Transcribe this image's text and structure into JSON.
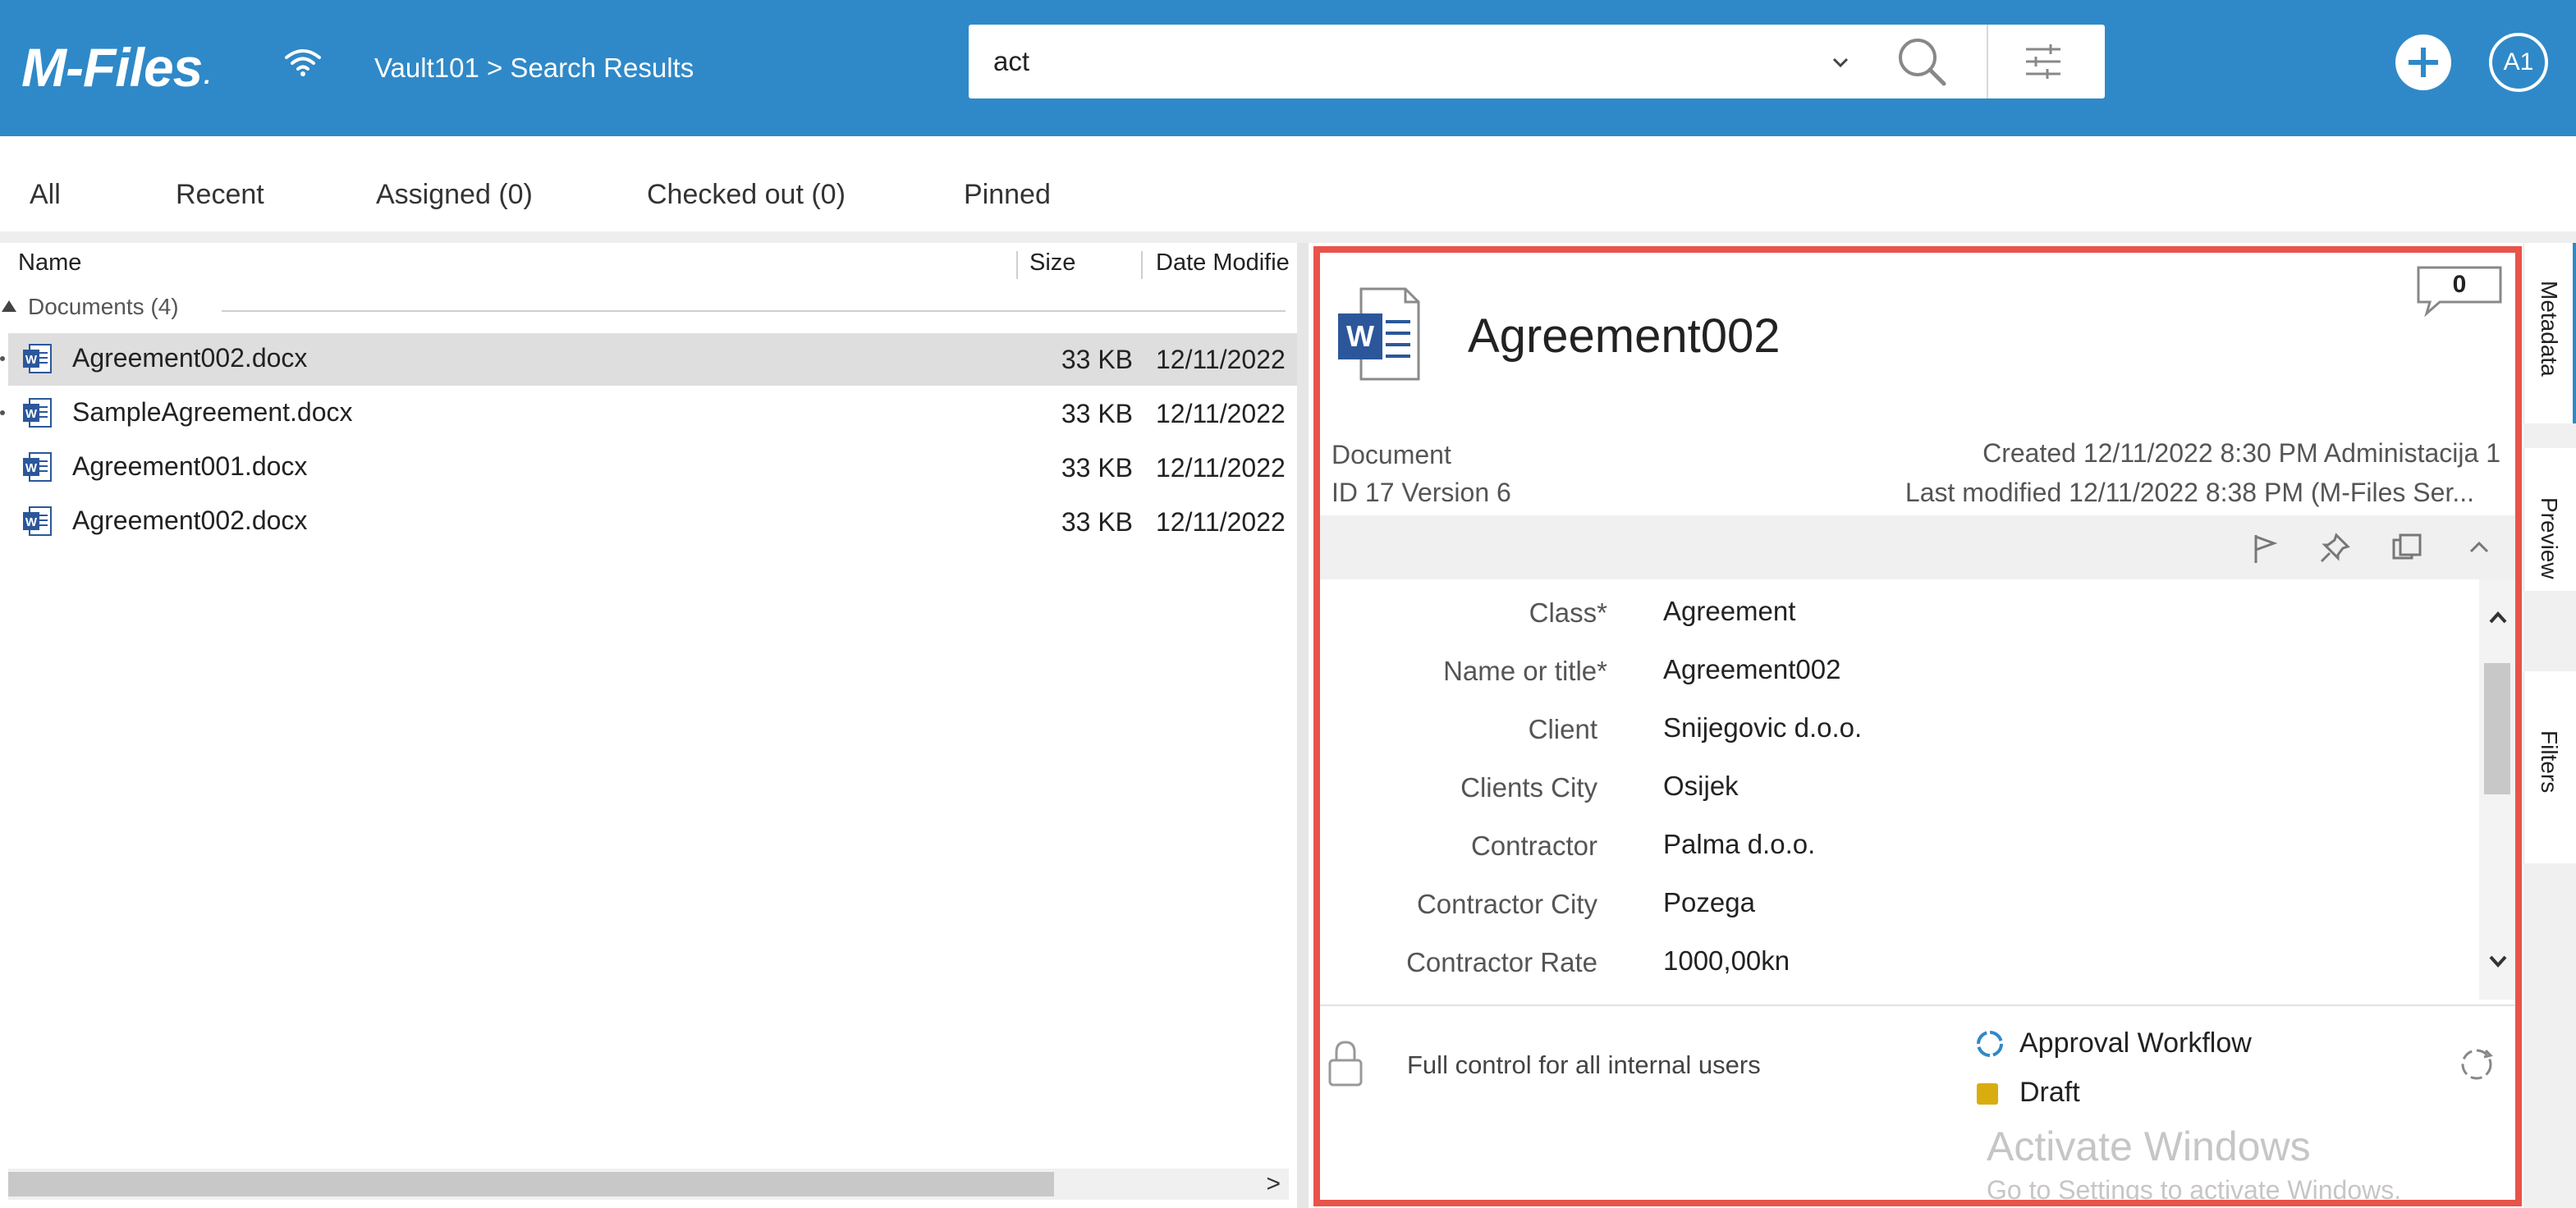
{
  "header": {
    "logo": "M-Files",
    "logo_mark": ".",
    "breadcrumb": "Vault101 > Search Results",
    "search_value": "act",
    "avatar": "A1",
    "accent": "#2f89c8"
  },
  "tabs": [
    "All",
    "Recent",
    "Assigned (0)",
    "Checked out (0)",
    "Pinned"
  ],
  "list": {
    "columns": {
      "name": "Name",
      "size": "Size",
      "date": "Date Modifie"
    },
    "group": "Documents (4)",
    "rows": [
      {
        "name": "Agreement002.docx",
        "size": "33 KB",
        "date": "12/11/2022",
        "selected": true
      },
      {
        "name": "SampleAgreement.docx",
        "size": "33 KB",
        "date": "12/11/2022"
      },
      {
        "name": "Agreement001.docx",
        "size": "33 KB",
        "date": "12/11/2022"
      },
      {
        "name": "Agreement002.docx",
        "size": "33 KB",
        "date": "12/11/2022"
      }
    ],
    "scroll_arrow": ">"
  },
  "metadata": {
    "title": "Agreement002",
    "comment_count": "0",
    "type": "Document",
    "id_version": "ID 17  Version 6",
    "created": "Created 12/11/2022 8:30 PM Administacija 1",
    "modified": "Last modified 12/11/2022 8:38 PM (M-Files Ser...",
    "properties": [
      {
        "label": "Class",
        "required": "*",
        "value": "Agreement"
      },
      {
        "label": "Name or title",
        "required": "*",
        "value": "Agreement002"
      },
      {
        "label": "Client",
        "required": "",
        "value": "Snijegovic d.o.o."
      },
      {
        "label": "Clients City",
        "required": "",
        "value": "Osijek"
      },
      {
        "label": "Contractor",
        "required": "",
        "value": "Palma d.o.o."
      },
      {
        "label": "Contractor City",
        "required": "",
        "value": "Pozega"
      },
      {
        "label": "Contractor Rate",
        "required": "",
        "value": "1000,00kn"
      }
    ],
    "permissions": "Full control for all internal users",
    "workflow": "Approval Workflow",
    "state": "Draft",
    "state_color": "#d9ad0f",
    "highlight_color": "#e8534a"
  },
  "watermark": {
    "title": "Activate Windows",
    "subtitle": "Go to Settings to activate Windows."
  },
  "side_tabs": [
    "Metadata",
    "Preview",
    "Filters"
  ]
}
